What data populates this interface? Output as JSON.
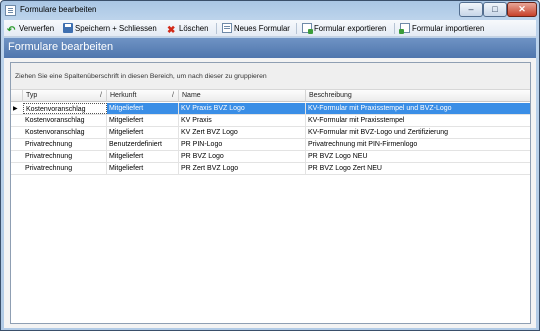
{
  "window": {
    "title": "Formulare bearbeiten"
  },
  "toolbar": {
    "discard": "Verwerfen",
    "save_close": "Speichern + Schliessen",
    "delete": "Löschen",
    "new_form": "Neues Formular",
    "export": "Formular exportieren",
    "import": "Formular importieren"
  },
  "header": {
    "title": "Formulare bearbeiten"
  },
  "grid": {
    "group_hint": "Ziehen Sie eine Spaltenüberschrift in diesen Bereich, um nach dieser zu gruppieren",
    "columns": [
      "Typ",
      "Herkunft",
      "Name",
      "Beschreibung"
    ],
    "sort_marker": "/",
    "rows": [
      [
        "Kostenvoranschlag",
        "Mitgeliefert",
        "KV Praxis BVZ Logo",
        "KV-Formular mit Praxisstempel und BVZ-Logo"
      ],
      [
        "Kostenvoranschlag",
        "Mitgeliefert",
        "KV Praxis",
        "KV-Formular mit Praxisstempel"
      ],
      [
        "Kostenvoranschlag",
        "Mitgeliefert",
        "KV Zert BVZ Logo",
        "KV-Formular mit BVZ-Logo und Zertifizierung"
      ],
      [
        "Privatrechnung",
        "Benutzerdefiniert",
        "PR PIN-Logo",
        "Privatrechnung mit PIN-Firmenlogo"
      ],
      [
        "Privatrechnung",
        "Mitgeliefert",
        "PR BVZ Logo",
        "PR BVZ Logo NEU"
      ],
      [
        "Privatrechnung",
        "Mitgeliefert",
        "PR Zert BVZ Logo",
        "PR BVZ Logo Zert NEU"
      ]
    ],
    "selected_row": 0
  },
  "colors": {
    "header": "#4f76ad",
    "selection": "#3a8ee6"
  }
}
